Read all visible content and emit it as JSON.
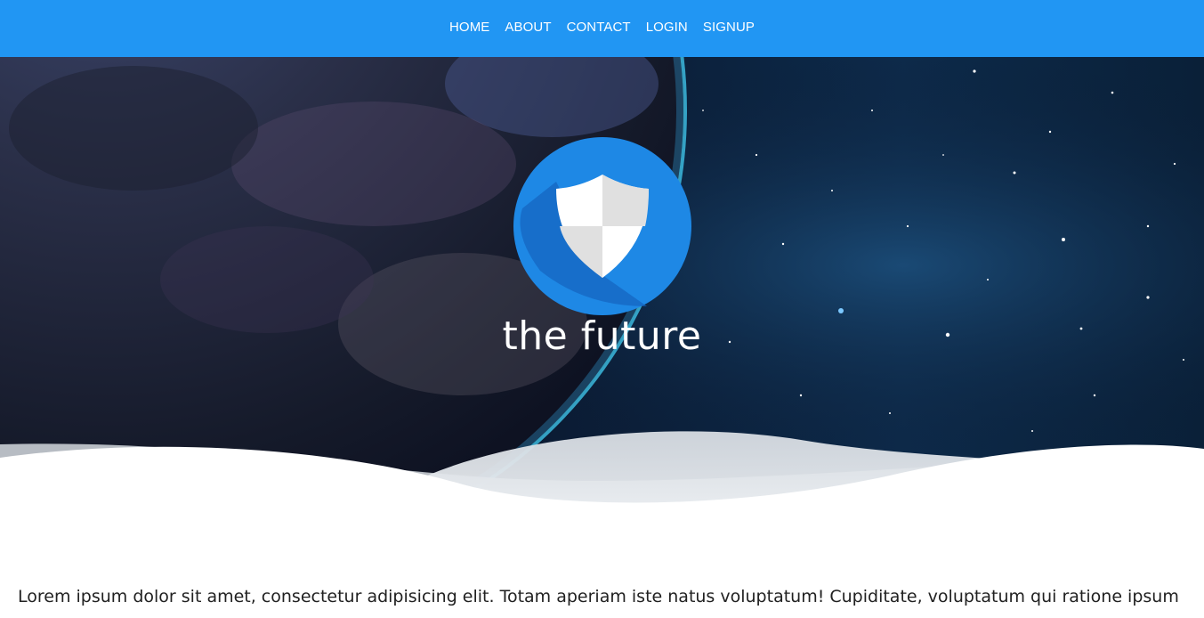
{
  "nav": {
    "items": [
      {
        "label": "HOME"
      },
      {
        "label": "ABOUT"
      },
      {
        "label": "CONTACT"
      },
      {
        "label": "LOGIN"
      },
      {
        "label": "SIGNUP"
      }
    ]
  },
  "hero": {
    "title": "the future",
    "logo_icon": "shield-icon"
  },
  "content": {
    "paragraph": "Lorem ipsum dolor sit amet, consectetur adipisicing elit. Totam aperiam iste natus voluptatum! Cupiditate, voluptatum qui ratione ipsum"
  },
  "colors": {
    "navbar": "#2196f3",
    "logo_circle": "#1e88e5",
    "text": "#212121"
  }
}
